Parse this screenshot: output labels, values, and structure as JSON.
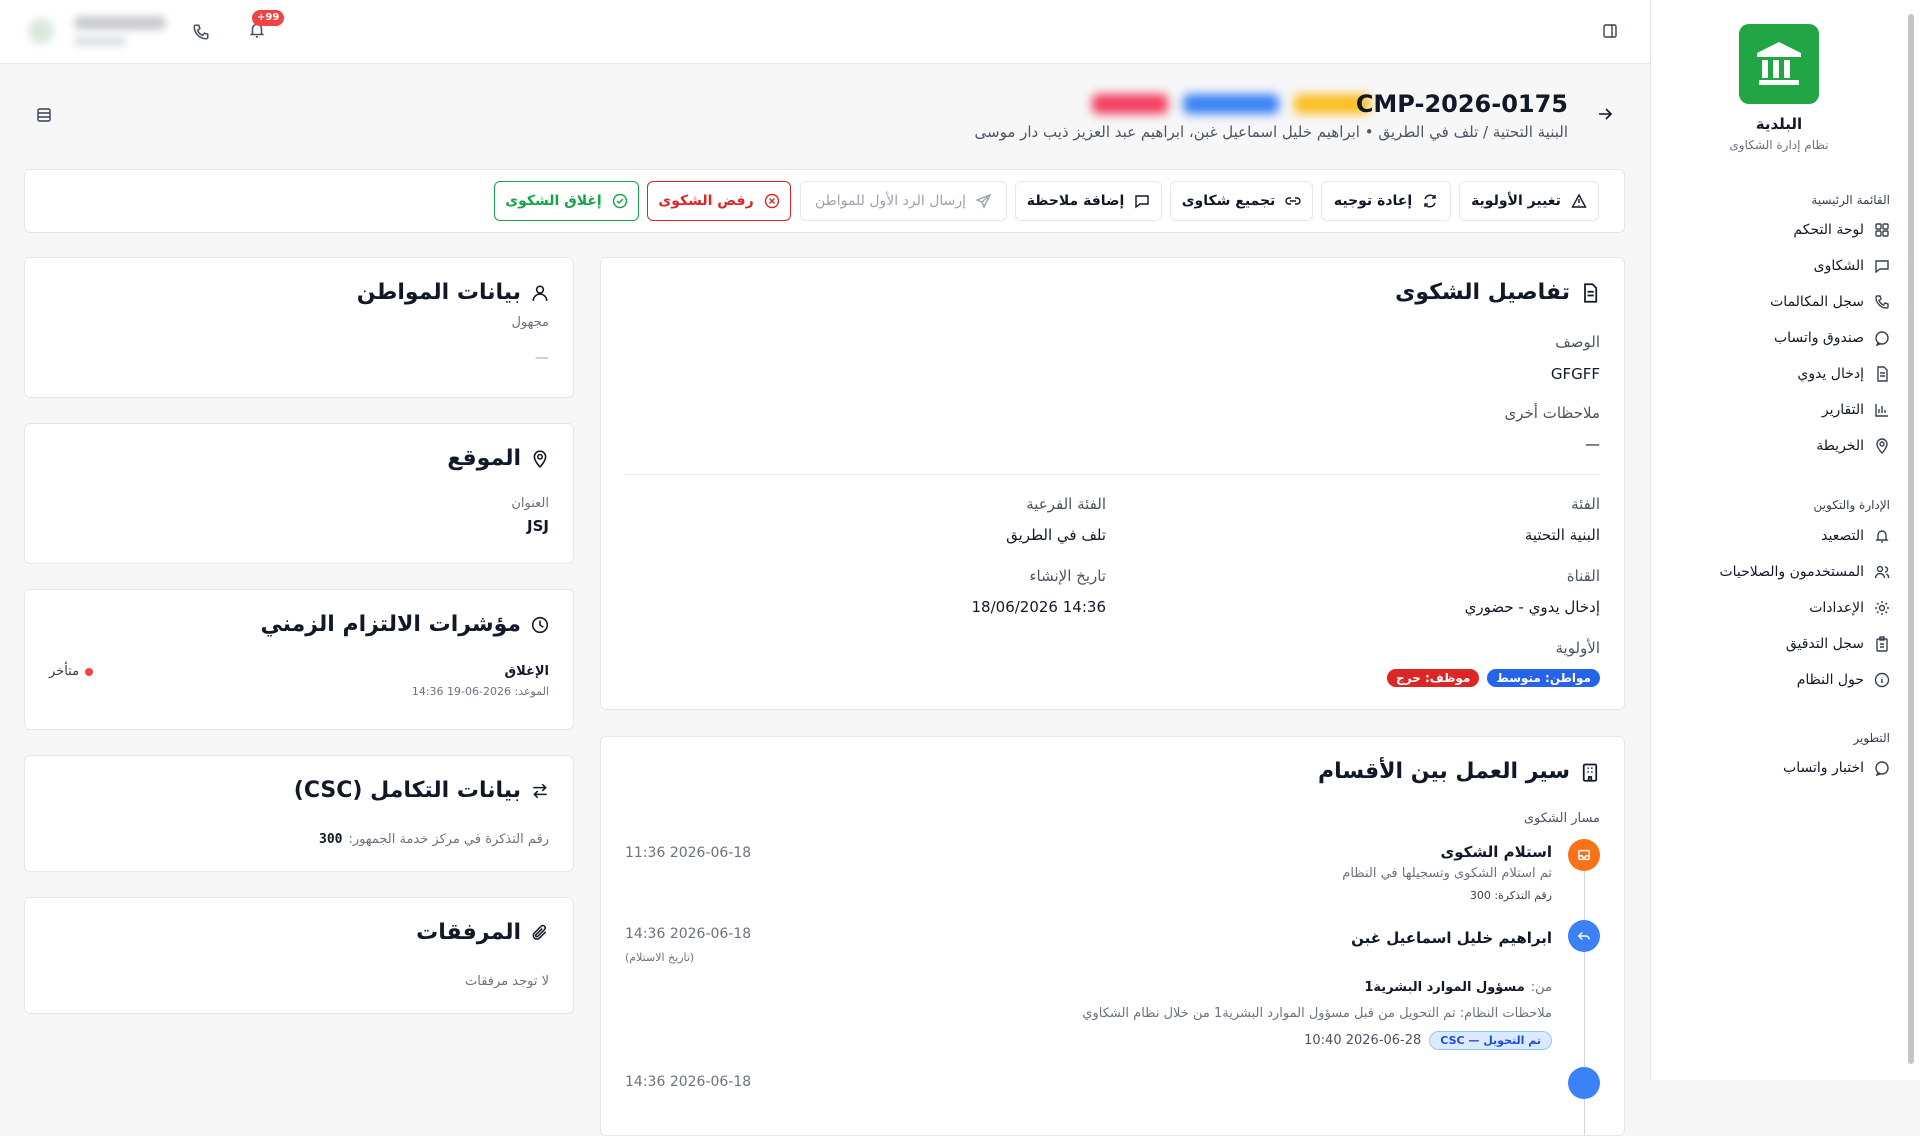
{
  "sidebar": {
    "brand_name": "البلدية",
    "brand_sub": "نظام إدارة الشكاوى",
    "sections": [
      {
        "label": "القائمة الرئيسية",
        "items": [
          {
            "label": "لوحة التحكم",
            "icon": "dashboard-icon"
          },
          {
            "label": "الشكاوى",
            "icon": "message-icon"
          },
          {
            "label": "سجل المكالمات",
            "icon": "phone-icon"
          },
          {
            "label": "صندوق واتساب",
            "icon": "chat-icon"
          },
          {
            "label": "إدخال يدوي",
            "icon": "document-icon"
          },
          {
            "label": "التقارير",
            "icon": "bar-chart-icon"
          },
          {
            "label": "الخريطة",
            "icon": "map-pin-icon"
          }
        ]
      },
      {
        "label": "الإدارة والتكوين",
        "items": [
          {
            "label": "التصعيد",
            "icon": "bell-icon"
          },
          {
            "label": "المستخدمون والصلاحيات",
            "icon": "users-icon"
          },
          {
            "label": "الإعدادات",
            "icon": "gear-icon"
          },
          {
            "label": "سجل التدقيق",
            "icon": "clipboard-icon"
          },
          {
            "label": "حول النظام",
            "icon": "info-icon"
          }
        ]
      },
      {
        "label": "التطوير",
        "items": [
          {
            "label": "اختبار واتساب",
            "icon": "chat-icon"
          }
        ]
      }
    ]
  },
  "topbar": {
    "notification_count": "+99"
  },
  "header": {
    "complaint_id": "CMP-2026-0175",
    "subtitle": "البنية التحتية / تلف في الطريق • ابراهيم خليل اسماعيل غبن، ابراهيم عبد العزيز ذيب دار موسى"
  },
  "actions": {
    "change_priority": "تغيير الأولوية",
    "reroute": "إعادة توجيه",
    "merge": "تجميع شكاوى",
    "add_note": "إضافة ملاحظة",
    "send_reply": "إرسال الرد الأول للمواطن",
    "reject": "رفض الشكوى",
    "close": "إغلاق الشكوى"
  },
  "details": {
    "title": "تفاصيل الشكوى",
    "description_label": "الوصف",
    "description_value": "GFGFF",
    "notes_label": "ملاحظات أخرى",
    "notes_value": "—",
    "category_label": "الفئة",
    "category_value": "البنية التحتية",
    "subcategory_label": "الفئة الفرعية",
    "subcategory_value": "تلف في الطريق",
    "channel_label": "القناة",
    "channel_value": "إدخال يدوي - حضوري",
    "created_label": "تاريخ الإنشاء",
    "created_value": "14:36 18/06/2026",
    "priority_label": "الأولوية",
    "priority_citizen": "مواطن: متوسط",
    "priority_staff": "موظف: حرج"
  },
  "workflow": {
    "title": "سير العمل بين الأقسام",
    "path_label": "مسار الشكوى",
    "e1_title": "استلام الشكوى",
    "e1_desc": "تم استلام الشكوى وتسجيلها في النظام",
    "e1_ticket": "رقم التذكرة: 300",
    "e1_time": "2026-06-18 11:36",
    "e2_title": "ابراهيم خليل اسماعيل غبن",
    "e2_time": "2026-06-18 14:36",
    "e2_time_note": "(تاريخ الاستلام)",
    "e2_from_label": "من:",
    "e2_from": "مسؤول الموارد البشرية1",
    "e2_notes": "ملاحظات النظام: تم التحويل من قبل مسؤول الموارد البشرية1 من خلال نظام الشكاوي",
    "e2_date": "2026-06-28 10:40",
    "e2_badge": "تم التحويل — CSC",
    "e3_time": "2026-06-18 14:36"
  },
  "citizen": {
    "title": "بيانات المواطن",
    "name": "مجهول",
    "value": "—"
  },
  "location": {
    "title": "الموقع",
    "address_label": "العنوان",
    "address_value": "JSJ"
  },
  "sla": {
    "title": "مؤشرات الالتزام الزمني",
    "item_label": "الإغلاق",
    "item_due": "الموعد: 2026-06-19 14:36",
    "status": "متأخر",
    "status_color": "#ef4444"
  },
  "integration": {
    "title": "بيانات التكامل (CSC)",
    "ticket_text": "رقم التذكرة في مركز خدمة الجمهور:",
    "ticket_value": "300"
  },
  "attachments": {
    "title": "المرفقات",
    "empty": "لا توجد مرفقات"
  },
  "colors": {
    "brand": "#22a544",
    "primary": "#2563eb",
    "danger": "#dc2626",
    "success": "#16a34a",
    "warning": "#f97316"
  }
}
